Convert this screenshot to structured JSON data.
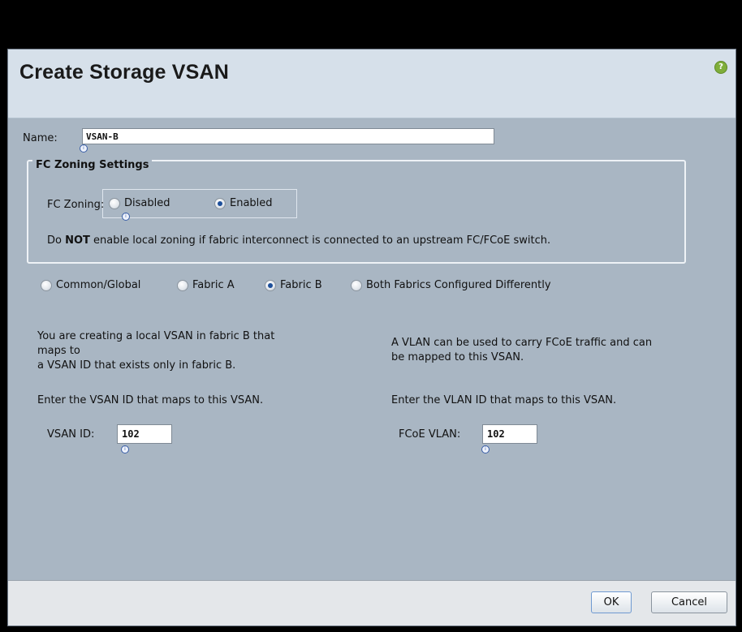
{
  "dialog": {
    "title": "Create Storage VSAN",
    "help_icon": "question-mark-icon"
  },
  "name_field": {
    "label": "Name:",
    "value": "VSAN-B"
  },
  "fc_zoning": {
    "legend": "FC Zoning Settings",
    "label": "FC Zoning:",
    "options": [
      {
        "label": "Disabled",
        "selected": false
      },
      {
        "label": "Enabled",
        "selected": true
      }
    ],
    "warning_prefix": "Do ",
    "warning_strong": "NOT",
    "warning_suffix": " enable local zoning if fabric interconnect is connected to an upstream FC/FCoE switch."
  },
  "fabric_options": [
    {
      "label": "Common/Global",
      "selected": false
    },
    {
      "label": "Fabric A",
      "selected": false
    },
    {
      "label": "Fabric B",
      "selected": true
    },
    {
      "label": "Both Fabrics Configured Differently",
      "selected": false
    }
  ],
  "left_panel": {
    "line1": "You are creating a local VSAN in fabric B that",
    "line2": "maps to",
    "line3": "a VSAN ID that exists only in fabric B.",
    "instruction": "Enter the VSAN ID that maps to this VSAN.",
    "field_label": "VSAN ID:",
    "field_value": "102"
  },
  "right_panel": {
    "line1": "A VLAN can be used to carry FCoE traffic and can",
    "line2": "be mapped to this VSAN.",
    "instruction": "Enter the VLAN ID that maps to this VSAN.",
    "field_label": "FCoE VLAN:",
    "field_value": "102"
  },
  "footer": {
    "ok_label": "OK",
    "cancel_label": "Cancel"
  },
  "colors": {
    "body_bg": "#a9b6c3",
    "header_bg": "#d6e0ea",
    "footer_bg": "#e4e7ea",
    "radio_selected": "#1d4f9a",
    "help_icon": "#7fae3a"
  }
}
